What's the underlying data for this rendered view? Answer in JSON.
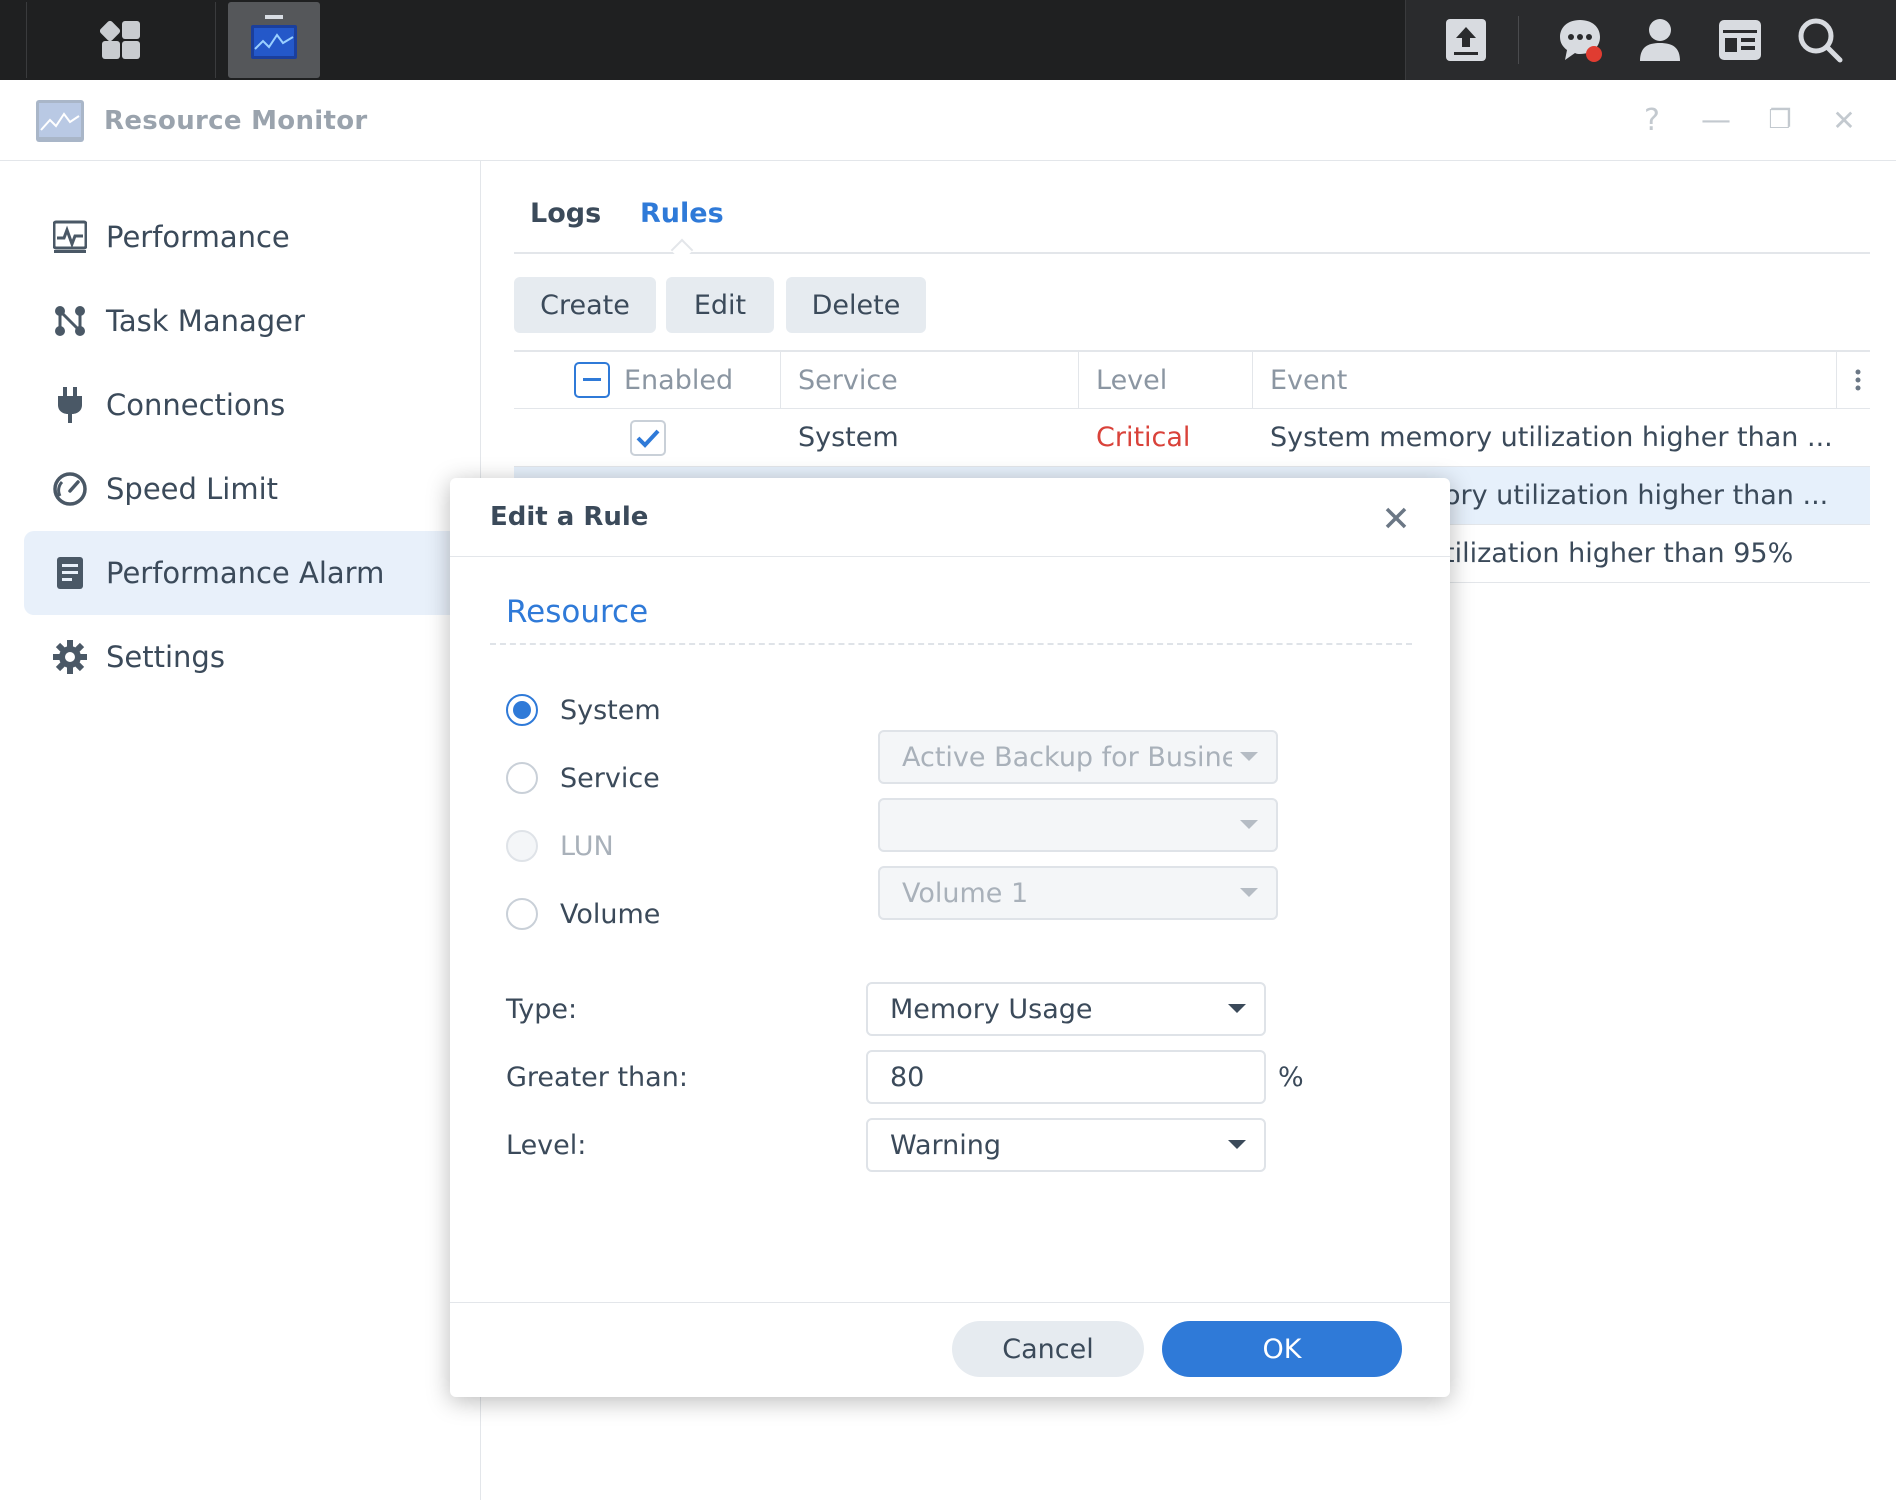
{
  "app": {
    "title": "Resource Monitor"
  },
  "window_controls": {
    "help": "?",
    "minimize": "—",
    "restore": "❐",
    "close": "✕"
  },
  "sidebar": {
    "items": [
      {
        "label": "Performance",
        "icon": "performance-icon"
      },
      {
        "label": "Task Manager",
        "icon": "task-manager-icon"
      },
      {
        "label": "Connections",
        "icon": "plug-icon"
      },
      {
        "label": "Speed Limit",
        "icon": "gauge-icon"
      },
      {
        "label": "Performance Alarm",
        "icon": "alarm-doc-icon",
        "active": true
      },
      {
        "label": "Settings",
        "icon": "gear-icon"
      }
    ]
  },
  "tabs": {
    "logs": "Logs",
    "rules": "Rules",
    "active": "Rules"
  },
  "toolbar": {
    "create": "Create",
    "edit": "Edit",
    "delete": "Delete"
  },
  "grid": {
    "columns": [
      "Enabled",
      "Service",
      "Level",
      "Event"
    ],
    "rows": [
      {
        "enabled": true,
        "service": "System",
        "level": "Critical",
        "event": "System memory utilization higher than ..."
      },
      {
        "event": "ory utilization higher than ..."
      },
      {
        "event": "tilization higher than 95%"
      }
    ]
  },
  "dialog": {
    "title": "Edit a Rule",
    "section": "Resource",
    "options": {
      "system": "System",
      "service": "Service",
      "lun": "LUN",
      "volume": "Volume"
    },
    "selected": "System",
    "service_select": "Active Backup for Busine",
    "lun_select": "",
    "volume_select": "Volume 1",
    "type_label": "Type:",
    "type_value": "Memory Usage",
    "greater_label": "Greater than:",
    "greater_value": "80",
    "unit": "%",
    "level_label": "Level:",
    "level_value": "Warning",
    "cancel": "Cancel",
    "ok": "OK"
  },
  "colors": {
    "accent": "#2f7ad8",
    "critical": "#d9423a",
    "taskbar": "#1f2021"
  }
}
